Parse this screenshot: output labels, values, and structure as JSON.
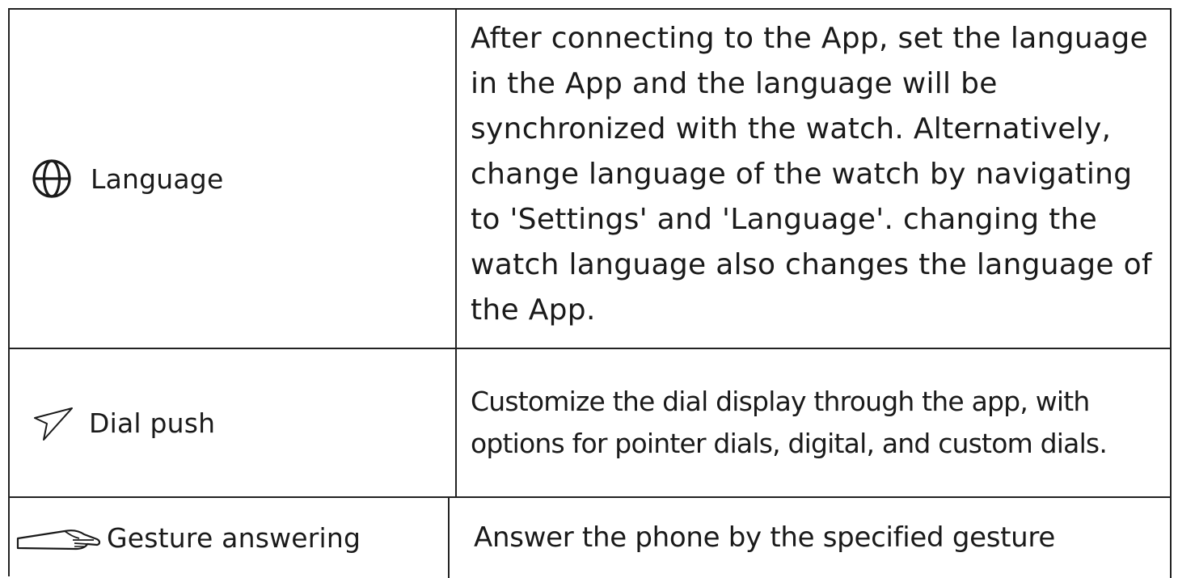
{
  "rows": [
    {
      "icon": "globe-icon",
      "name": "Language",
      "description": "After connecting to the App, set the language in the App and the language will be synchronized with the watch. Alternatively, change language of the watch by navigating to 'Settings' and 'Language'. changing the watch language also changes the language of the App."
    },
    {
      "icon": "send-icon",
      "name": "Dial push",
      "description": "Customize the dial display through the app, with options for pointer dials, digital, and custom dials."
    },
    {
      "icon": "hand-gesture-icon",
      "name": "Gesture answering",
      "description": "Answer the phone by the specified gesture"
    }
  ]
}
